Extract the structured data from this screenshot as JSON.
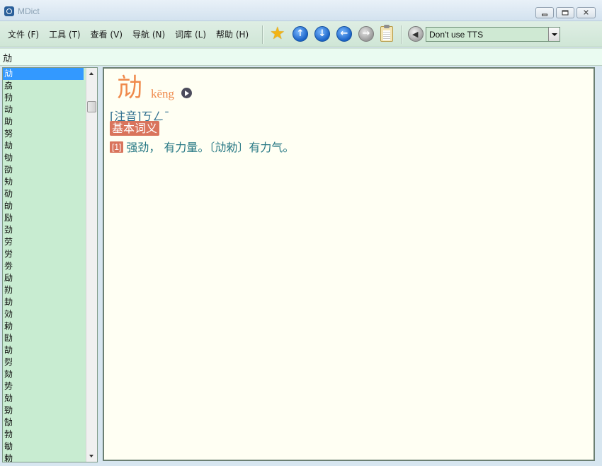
{
  "window": {
    "title": "MDict"
  },
  "menu": [
    "文件 (F)",
    "工具 (T)",
    "查看 (V)",
    "导航 (N)",
    "词库 (L)",
    "帮助 (H)"
  ],
  "toolbar": {
    "icons": [
      "star-icon",
      "arrow-up-icon",
      "arrow-down-icon",
      "arrow-left-icon",
      "arrow-right-icon",
      "clipboard-icon",
      "speaker-icon"
    ],
    "tts_value": "Don't use TTS"
  },
  "search": {
    "value": "劥"
  },
  "wordlist": {
    "selected_index": 0,
    "items": [
      "劥",
      "劦",
      "劧",
      "动",
      "助",
      "努",
      "劫",
      "劬",
      "劭",
      "劮",
      "劯",
      "劰",
      "励",
      "劲",
      "劳",
      "労",
      "劵",
      "劶",
      "劷",
      "劸",
      "効",
      "勅",
      "劻",
      "劼",
      "劽",
      "劾",
      "势",
      "勀",
      "勁",
      "勂",
      "勃",
      "勄",
      "勅"
    ]
  },
  "entry": {
    "headword": "劥",
    "pinyin": "kēng",
    "zhuyin_label": "[注音]",
    "zhuyin": "ㄎㄥˉ",
    "section_title": "基本词义",
    "definitions": [
      {
        "num": "[1]",
        "text": "强劲， 有力量。〔劥勑〕有力气。"
      }
    ]
  },
  "colors": {
    "headword": "#ef8a4c",
    "badge": "#d9745c",
    "definition_text": "#2a7a86",
    "list_bg": "#c8ecd1",
    "content_bg": "#fffff3",
    "selection": "#3399ff"
  }
}
